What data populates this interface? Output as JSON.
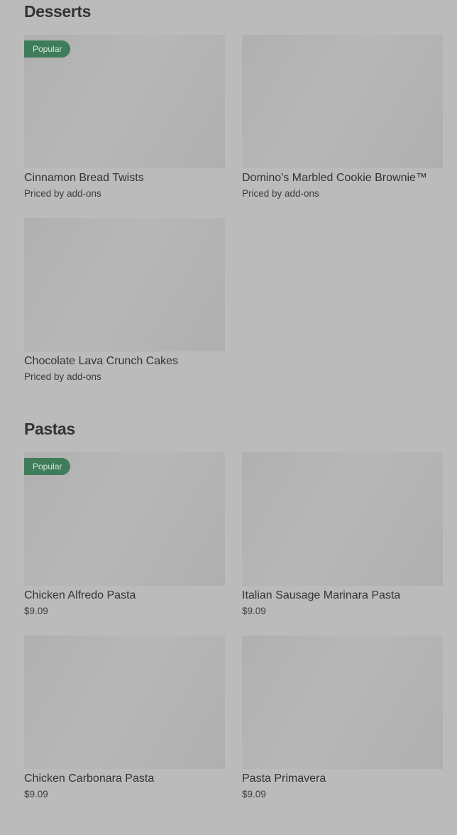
{
  "desserts": {
    "title": "Desserts",
    "items": [
      {
        "name": "Cinnamon Bread Twists",
        "price": "Priced by add-ons",
        "badge": "Popular"
      },
      {
        "name": "Domino's Marbled Cookie Brownie™",
        "price": "Priced by add-ons"
      },
      {
        "name": "Chocolate Lava Crunch Cakes",
        "price": "Priced by add-ons"
      }
    ]
  },
  "pastas": {
    "title": "Pastas",
    "items": [
      {
        "name": "Chicken Alfredo Pasta",
        "price": "$9.09",
        "badge": "Popular"
      },
      {
        "name": "Italian Sausage Marinara Pasta",
        "price": "$9.09"
      },
      {
        "name": "Chicken Carbonara Pasta",
        "price": "$9.09"
      },
      {
        "name": "Pasta Primavera",
        "price": "$9.09"
      }
    ]
  },
  "colors": {
    "background": "#bbbbbb",
    "badge": "#3e7c5a",
    "placeholder": "#b3b3b3"
  }
}
